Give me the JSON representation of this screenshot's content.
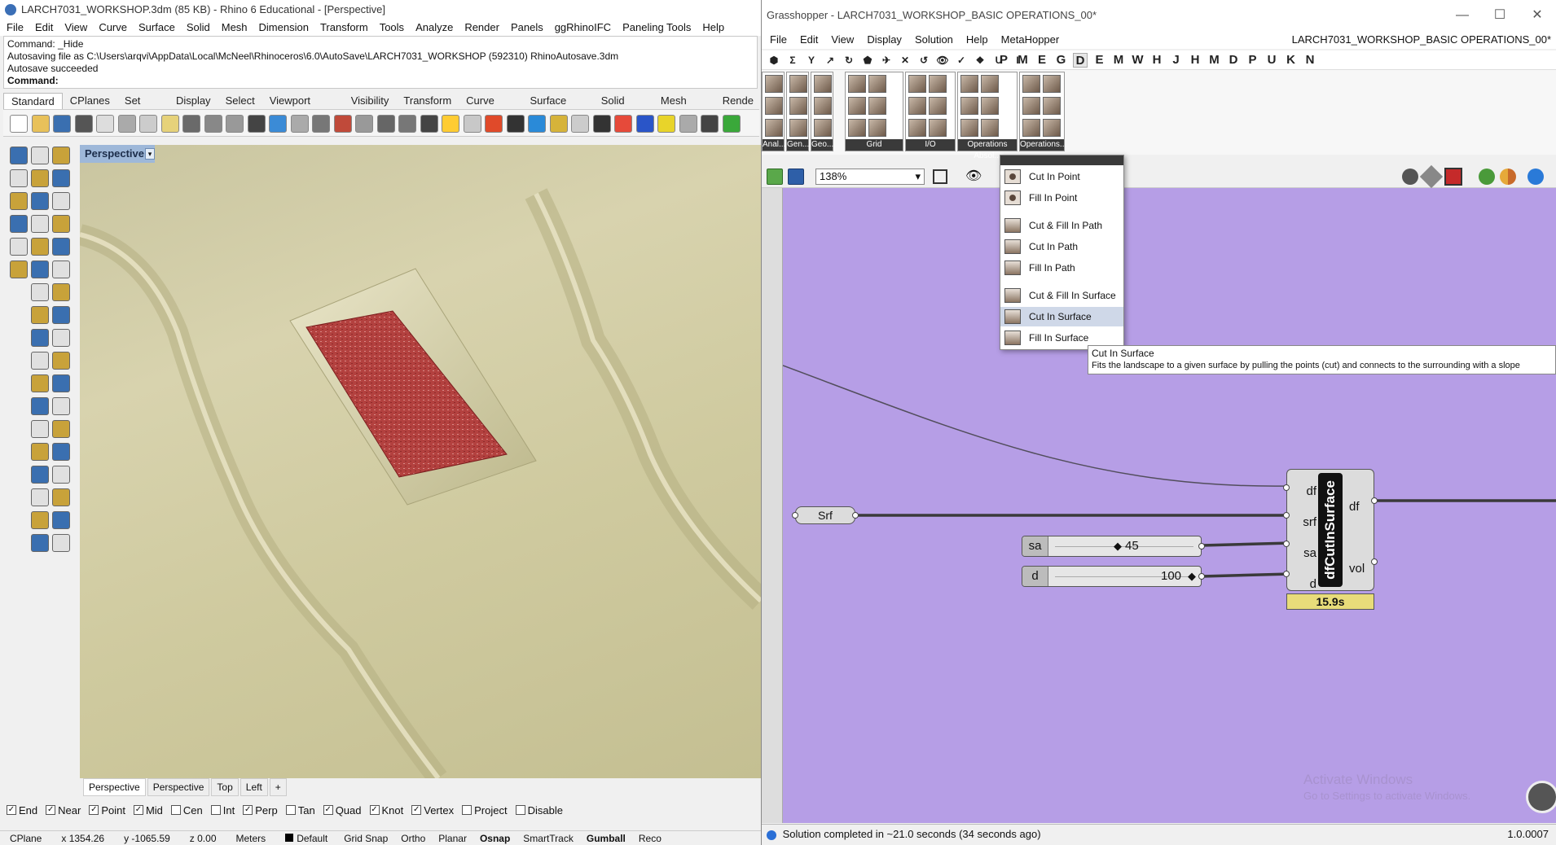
{
  "rhino": {
    "title": "LARCH7031_WORKSHOP.3dm (85 KB) - Rhino 6 Educational - [Perspective]",
    "menu": [
      "File",
      "Edit",
      "View",
      "Curve",
      "Surface",
      "Solid",
      "Mesh",
      "Dimension",
      "Transform",
      "Tools",
      "Analyze",
      "Render",
      "Panels",
      "ggRhinoIFC",
      "Paneling Tools",
      "Help"
    ],
    "command_lines": [
      "Command: _Hide",
      "Autosaving file as C:\\Users\\arqvi\\AppData\\Local\\McNeel\\Rhinoceros\\6.0\\AutoSave\\LARCH7031_WORKSHOP (592310) RhinoAutosave.3dm",
      "Autosave succeeded"
    ],
    "command_prompt": "Command:",
    "tabs": [
      "Standard",
      "CPlanes",
      "Set View",
      "Display",
      "Select",
      "Viewport Layout",
      "Visibility",
      "Transform",
      "Curve Tools",
      "Surface Tools",
      "Solid Tools",
      "Mesh Tools",
      "Rende"
    ],
    "viewport_label": "Perspective",
    "viewport_tabs": [
      "Perspective",
      "Perspective",
      "Top",
      "Left"
    ],
    "osnaps": [
      {
        "label": "End",
        "checked": true
      },
      {
        "label": "Near",
        "checked": true
      },
      {
        "label": "Point",
        "checked": true
      },
      {
        "label": "Mid",
        "checked": true
      },
      {
        "label": "Cen",
        "checked": false
      },
      {
        "label": "Int",
        "checked": false
      },
      {
        "label": "Perp",
        "checked": true
      },
      {
        "label": "Tan",
        "checked": false
      },
      {
        "label": "Quad",
        "checked": true
      },
      {
        "label": "Knot",
        "checked": true
      },
      {
        "label": "Vertex",
        "checked": true
      },
      {
        "label": "Project",
        "checked": false
      },
      {
        "label": "Disable",
        "checked": false
      }
    ],
    "status": {
      "cplane": "CPlane",
      "x": "x 1354.26",
      "y": "y -1065.59",
      "z": "z 0.00",
      "units": "Meters",
      "layer": "Default",
      "toggles": [
        "Grid Snap",
        "Ortho",
        "Planar",
        "Osnap",
        "SmartTrack",
        "Gumball",
        "Reco"
      ]
    }
  },
  "gh": {
    "title": "Grasshopper - LARCH7031_WORKSHOP_BASIC OPERATIONS_00*",
    "menu": [
      "File",
      "Edit",
      "View",
      "Display",
      "Solution",
      "Help",
      "MetaHopper"
    ],
    "doc_name": "LARCH7031_WORKSHOP_BASIC OPERATIONS_00*",
    "tab_letters": [
      "P",
      "M",
      "E",
      "G",
      "D",
      "E",
      "M",
      "W",
      "H",
      "J",
      "H",
      "M",
      "D",
      "P",
      "U",
      "K",
      "N"
    ],
    "ribbon_groups": [
      "Anal...",
      "Gen...",
      "Geo...",
      "Grid",
      "I/O",
      "Operations Absol...",
      "Operations..."
    ],
    "zoom": "138%",
    "dropdown_items": [
      {
        "label": "Cut In Point",
        "icon": "cut-point-icon"
      },
      {
        "label": "Fill In Point",
        "icon": "fill-point-icon"
      },
      {
        "label": "Cut & Fill In Path",
        "icon": "cut-fill-path-icon"
      },
      {
        "label": "Cut In Path",
        "icon": "cut-path-icon"
      },
      {
        "label": "Fill In Path",
        "icon": "fill-path-icon"
      },
      {
        "label": "Cut & Fill In Surface",
        "icon": "cut-fill-surface-icon"
      },
      {
        "label": "Cut In Surface",
        "icon": "cut-surface-icon"
      },
      {
        "label": "Fill In Surface",
        "icon": "fill-surface-icon"
      }
    ],
    "tooltip": {
      "title": "Cut In Surface",
      "description": "Fits the landscape to a given surface by pulling the points (cut) and connects to the surrounding with a slope"
    },
    "components": {
      "srf_param": "Srf",
      "slider_sa": {
        "label": "sa",
        "value": "45"
      },
      "slider_d": {
        "label": "d",
        "value": "100"
      },
      "main": {
        "name": "dfCutInSurface",
        "inputs": [
          "df",
          "srf",
          "sa",
          "d"
        ],
        "outputs": [
          "df",
          "vol"
        ],
        "time": "15.9s"
      }
    },
    "watermark": {
      "title": "Activate Windows",
      "sub": "Go to Settings to activate Windows."
    },
    "status": "Solution completed in ~21.0 seconds (34 seconds ago)",
    "version": "1.0.0007"
  },
  "colors": {
    "canvas": "#b69ee6",
    "terrain": "#d4cfa6",
    "cut_surface": "#b03a3a",
    "viewport_label": "#9eb8d9"
  }
}
